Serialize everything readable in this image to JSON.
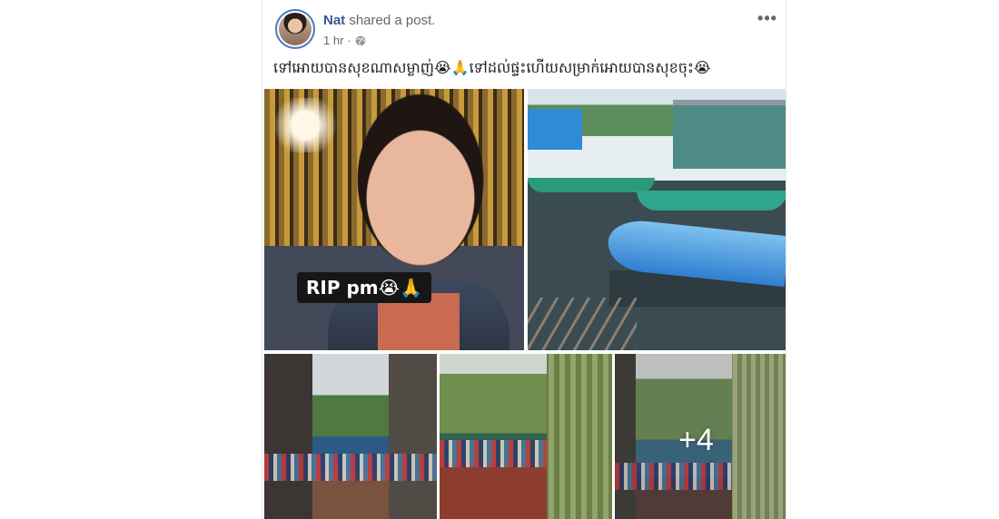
{
  "post": {
    "author": "Nat",
    "action": "shared a post.",
    "time": "1 hr",
    "text": "ទៅអោយបានសុខណាសម្លាញ់😭🙏ទៅដល់ផ្ទះហើយសម្រាក់អោយបានសុខចុះ😭",
    "more_label": "•••",
    "privacy_icon": "globe-icon"
  },
  "photos": {
    "rip_caption": "RIP pm😭🙏",
    "more_count": "+4"
  }
}
